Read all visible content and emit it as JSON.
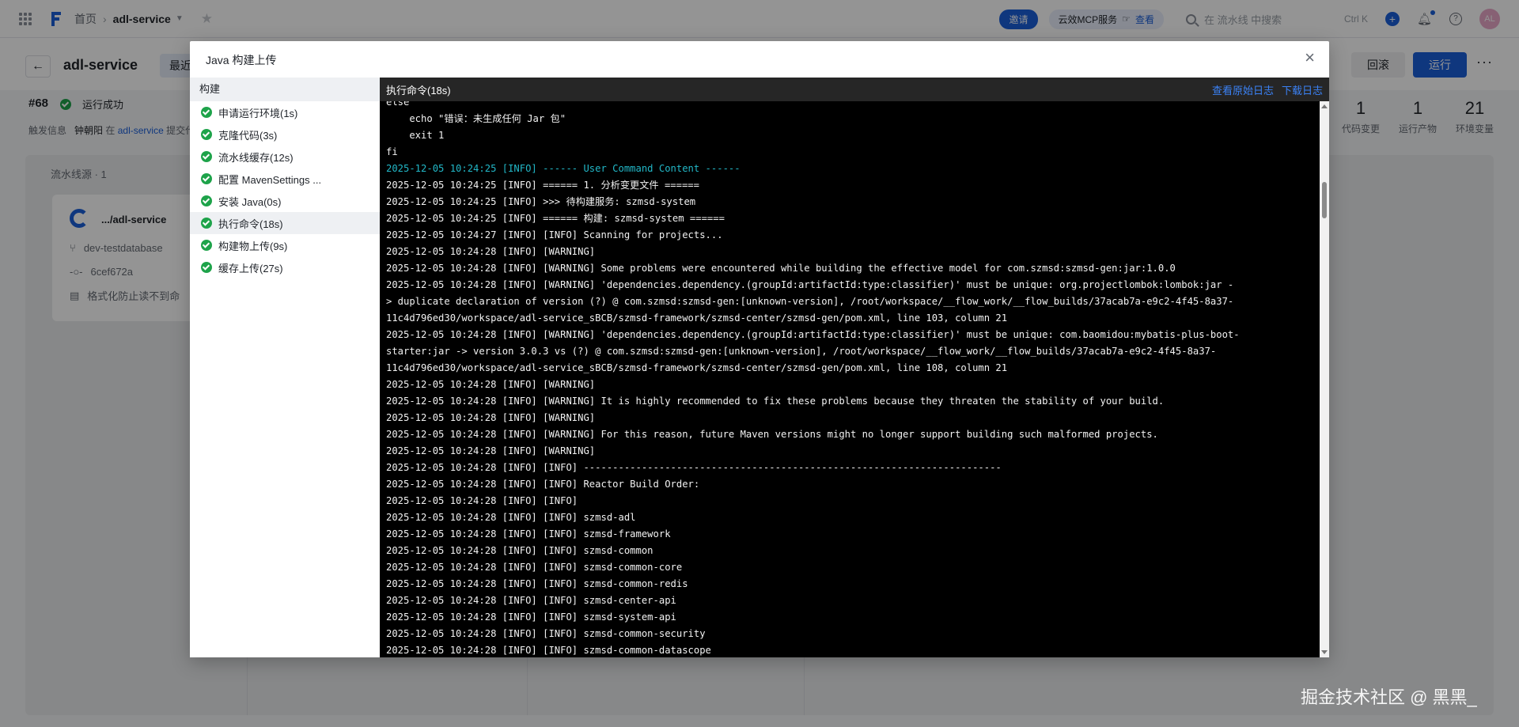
{
  "topbar": {
    "home": "首页",
    "project": "adl-service",
    "invite": "邀请",
    "mcp_label": "云效MCP服务",
    "mcp_view": "查看",
    "search_placeholder": "在 流水线 中搜索",
    "shortcut": "Ctrl K",
    "avatar": "AL"
  },
  "header": {
    "title": "adl-service",
    "recent_tab": "最近",
    "rollback": "回滚",
    "run": "运行",
    "more": "···"
  },
  "run": {
    "number": "#68",
    "status": "运行成功",
    "trigger_label": "触发信息",
    "trigger_user": "钟朝阳",
    "trigger_in": "在",
    "trigger_repo": "adl-service",
    "trigger_action": "提交代"
  },
  "stats": [
    {
      "value": "1",
      "label": "代码变更"
    },
    {
      "value": "1",
      "label": "运行产物"
    },
    {
      "value": "21",
      "label": "环境变量"
    }
  ],
  "pipeline": {
    "source_label": "流水线源 · 1",
    "repo": ".../adl-service",
    "branch": "dev-testdatabase",
    "commit": "6cef672a",
    "message": "格式化防止读不到命"
  },
  "modal": {
    "title": "Java 构建上传",
    "close": "×",
    "steps_header": "构建",
    "steps": [
      {
        "label": "申请运行环境(1s)"
      },
      {
        "label": "克隆代码(3s)"
      },
      {
        "label": "流水线缓存(12s)"
      },
      {
        "label": "配置 MavenSettings ..."
      },
      {
        "label": "安装 Java(0s)"
      },
      {
        "label": "执行命令(18s)"
      },
      {
        "label": "构建物上传(9s)"
      },
      {
        "label": "缓存上传(27s)"
      }
    ],
    "active_step": 5,
    "log_title": "执行命令(18s)",
    "view_raw": "查看原始日志",
    "download": "下载日志",
    "log_lines": [
      {
        "text": "else",
        "color": "white"
      },
      {
        "text": "    echo \"错误：未生成任何 Jar 包\"",
        "color": "white"
      },
      {
        "text": "    exit 1",
        "color": "white"
      },
      {
        "text": "fi",
        "color": "white"
      },
      {
        "text": "2025-12-05 10:24:25 [INFO] ------ User Command Content ------",
        "color": "cyan"
      },
      {
        "text": "2025-12-05 10:24:25 [INFO] ====== 1. 分析变更文件 ======",
        "color": "white"
      },
      {
        "text": "2025-12-05 10:24:25 [INFO] >>> 待构建服务: szmsd-system",
        "color": "white"
      },
      {
        "text": "2025-12-05 10:24:25 [INFO] ====== 构建: szmsd-system ======",
        "color": "white"
      },
      {
        "text": "2025-12-05 10:24:27 [INFO] [INFO] Scanning for projects...",
        "color": "white"
      },
      {
        "text": "2025-12-05 10:24:28 [INFO] [WARNING]",
        "color": "white"
      },
      {
        "text": "2025-12-05 10:24:28 [INFO] [WARNING] Some problems were encountered while building the effective model for com.szmsd:szmsd-gen:jar:1.0.0",
        "color": "white"
      },
      {
        "text": "2025-12-05 10:24:28 [INFO] [WARNING] 'dependencies.dependency.(groupId:artifactId:type:classifier)' must be unique: org.projectlombok:lombok:jar -",
        "color": "white"
      },
      {
        "text": "> duplicate declaration of version (?) @ com.szmsd:szmsd-gen:[unknown-version], /root/workspace/__flow_work/__flow_builds/37acab7a-e9c2-4f45-8a37-",
        "color": "white"
      },
      {
        "text": "11c4d796ed30/workspace/adl-service_sBCB/szmsd-framework/szmsd-center/szmsd-gen/pom.xml, line 103, column 21",
        "color": "white"
      },
      {
        "text": "2025-12-05 10:24:28 [INFO] [WARNING] 'dependencies.dependency.(groupId:artifactId:type:classifier)' must be unique: com.baomidou:mybatis-plus-boot-",
        "color": "white"
      },
      {
        "text": "starter:jar -> version 3.0.3 vs (?) @ com.szmsd:szmsd-gen:[unknown-version], /root/workspace/__flow_work/__flow_builds/37acab7a-e9c2-4f45-8a37-",
        "color": "white"
      },
      {
        "text": "11c4d796ed30/workspace/adl-service_sBCB/szmsd-framework/szmsd-center/szmsd-gen/pom.xml, line 108, column 21",
        "color": "white"
      },
      {
        "text": "2025-12-05 10:24:28 [INFO] [WARNING]",
        "color": "white"
      },
      {
        "text": "2025-12-05 10:24:28 [INFO] [WARNING] It is highly recommended to fix these problems because they threaten the stability of your build.",
        "color": "white"
      },
      {
        "text": "2025-12-05 10:24:28 [INFO] [WARNING]",
        "color": "white"
      },
      {
        "text": "2025-12-05 10:24:28 [INFO] [WARNING] For this reason, future Maven versions might no longer support building such malformed projects.",
        "color": "white"
      },
      {
        "text": "2025-12-05 10:24:28 [INFO] [WARNING]",
        "color": "white"
      },
      {
        "text": "2025-12-05 10:24:28 [INFO] [INFO] ------------------------------------------------------------------------",
        "color": "white"
      },
      {
        "text": "2025-12-05 10:24:28 [INFO] [INFO] Reactor Build Order:",
        "color": "white"
      },
      {
        "text": "2025-12-05 10:24:28 [INFO] [INFO]",
        "color": "white"
      },
      {
        "text": "2025-12-05 10:24:28 [INFO] [INFO] szmsd-adl",
        "color": "white"
      },
      {
        "text": "2025-12-05 10:24:28 [INFO] [INFO] szmsd-framework",
        "color": "white"
      },
      {
        "text": "2025-12-05 10:24:28 [INFO] [INFO] szmsd-common",
        "color": "white"
      },
      {
        "text": "2025-12-05 10:24:28 [INFO] [INFO] szmsd-common-core",
        "color": "white"
      },
      {
        "text": "2025-12-05 10:24:28 [INFO] [INFO] szmsd-common-redis",
        "color": "white"
      },
      {
        "text": "2025-12-05 10:24:28 [INFO] [INFO] szmsd-center-api",
        "color": "white"
      },
      {
        "text": "2025-12-05 10:24:28 [INFO] [INFO] szmsd-system-api",
        "color": "white"
      },
      {
        "text": "2025-12-05 10:24:28 [INFO] [INFO] szmsd-common-security",
        "color": "white"
      },
      {
        "text": "2025-12-05 10:24:28 [INFO] [INFO] szmsd-common-datascope",
        "color": "white"
      }
    ]
  },
  "watermark": "掘金技术社区 @ 黑黑_",
  "colors": {
    "accent": "#1b5fd9",
    "success": "#1ea34a",
    "log_cyan": "#22b8c8",
    "log_text": "#f2f2f2"
  },
  "icons": [
    "apps-grid-icon",
    "flow-logo-icon",
    "star-icon",
    "search-icon",
    "plus-icon",
    "bell-icon",
    "help-icon",
    "back-arrow-icon",
    "check-circle-icon",
    "close-icon",
    "branch-icon",
    "commit-icon",
    "message-icon"
  ]
}
